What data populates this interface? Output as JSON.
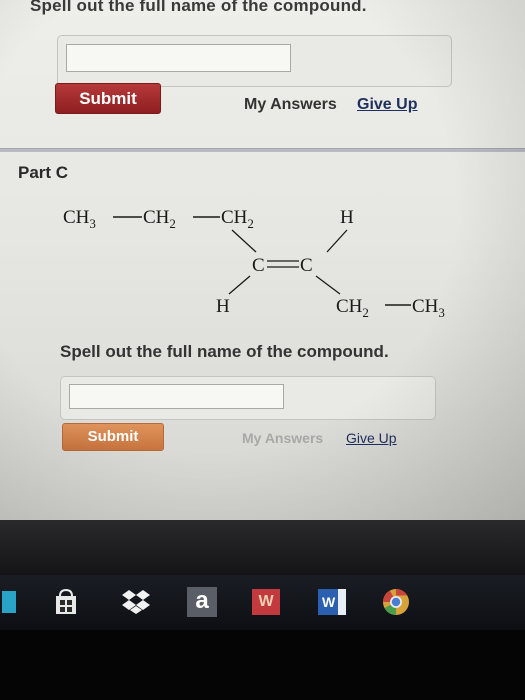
{
  "previous_part": {
    "prompt": "Spell out the full name of the compound.",
    "answer_value": "",
    "submit_label": "Submit",
    "my_answers_label": "My Answers",
    "give_up_label": "Give Up"
  },
  "part_c": {
    "title": "Part C",
    "molecule": {
      "left_chain": [
        "CH3",
        "CH2",
        "CH2"
      ],
      "top_right": "H",
      "center_left": "C",
      "center_right": "C",
      "bottom_left": "H",
      "bottom_right_chain": [
        "CH2",
        "CH3"
      ]
    },
    "prompt": "Spell out the full name of the compound.",
    "answer_value": "",
    "submit_label": "Submit",
    "my_answers_label": "My Answers",
    "give_up_label": "Give Up"
  },
  "taskbar": {
    "icons": [
      "windows-tile-icon",
      "store-icon",
      "dropbox-icon",
      "amazon-icon",
      "wps-icon",
      "word-icon",
      "chrome-icon"
    ],
    "amazon_glyph": "a",
    "wps_glyph": "W",
    "word_glyph": "W"
  },
  "colors": {
    "submit_active": "#9e2a2b",
    "submit_disabled": "#d9834a",
    "give_up_link": "#1f2f5e"
  }
}
